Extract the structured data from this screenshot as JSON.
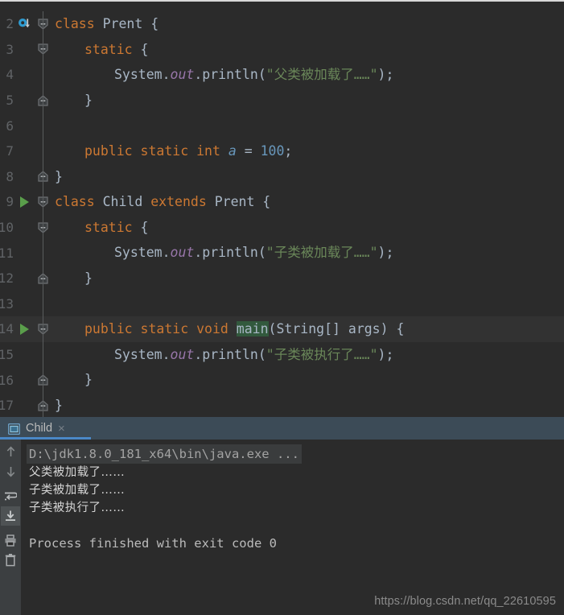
{
  "editor": {
    "lines": [
      {
        "num": "2",
        "marker": "subclass-icon",
        "fold": "open",
        "indent": 0,
        "tokens": [
          {
            "t": "class",
            "c": "kw"
          },
          {
            "t": " ",
            "c": "pun"
          },
          {
            "t": "Prent",
            "c": "cls"
          },
          {
            "t": " {",
            "c": "pun"
          }
        ]
      },
      {
        "num": "3",
        "marker": "none",
        "fold": "open",
        "indent": 1,
        "tokens": [
          {
            "t": "static",
            "c": "kw"
          },
          {
            "t": " {",
            "c": "pun"
          }
        ]
      },
      {
        "num": "4",
        "marker": "none",
        "fold": "line",
        "indent": 2,
        "tokens": [
          {
            "t": "System",
            "c": "cls"
          },
          {
            "t": ".",
            "c": "pun"
          },
          {
            "t": "out",
            "c": "fld"
          },
          {
            "t": ".",
            "c": "pun"
          },
          {
            "t": "println",
            "c": "mth"
          },
          {
            "t": "(",
            "c": "pun"
          },
          {
            "t": "\"父类被加载了……\"",
            "c": "str"
          },
          {
            "t": ");",
            "c": "pun"
          }
        ]
      },
      {
        "num": "5",
        "marker": "none",
        "fold": "close",
        "indent": 1,
        "tokens": [
          {
            "t": "}",
            "c": "pun"
          }
        ]
      },
      {
        "num": "6",
        "marker": "none",
        "fold": "line",
        "indent": 0,
        "tokens": []
      },
      {
        "num": "7",
        "marker": "none",
        "fold": "line",
        "indent": 1,
        "tokens": [
          {
            "t": "public",
            "c": "kw"
          },
          {
            "t": " ",
            "c": "pun"
          },
          {
            "t": "static",
            "c": "kw"
          },
          {
            "t": " ",
            "c": "pun"
          },
          {
            "t": "int",
            "c": "kw"
          },
          {
            "t": " ",
            "c": "pun"
          },
          {
            "t": "a",
            "c": "fldb"
          },
          {
            "t": " = ",
            "c": "pun"
          },
          {
            "t": "100",
            "c": "num"
          },
          {
            "t": ";",
            "c": "pun"
          }
        ]
      },
      {
        "num": "8",
        "marker": "none",
        "fold": "close",
        "indent": 0,
        "tokens": [
          {
            "t": "}",
            "c": "pun"
          }
        ]
      },
      {
        "num": "9",
        "marker": "run-icon",
        "fold": "open",
        "indent": 0,
        "tokens": [
          {
            "t": "class",
            "c": "kw"
          },
          {
            "t": " ",
            "c": "pun"
          },
          {
            "t": "Child",
            "c": "cls"
          },
          {
            "t": " ",
            "c": "pun"
          },
          {
            "t": "extends",
            "c": "kw"
          },
          {
            "t": " ",
            "c": "pun"
          },
          {
            "t": "Prent",
            "c": "cls"
          },
          {
            "t": " {",
            "c": "pun"
          }
        ]
      },
      {
        "num": "10",
        "marker": "none",
        "fold": "open",
        "indent": 1,
        "tokens": [
          {
            "t": "static",
            "c": "kw"
          },
          {
            "t": " {",
            "c": "pun"
          }
        ]
      },
      {
        "num": "11",
        "marker": "none",
        "fold": "line",
        "indent": 2,
        "tokens": [
          {
            "t": "System",
            "c": "cls"
          },
          {
            "t": ".",
            "c": "pun"
          },
          {
            "t": "out",
            "c": "fld"
          },
          {
            "t": ".",
            "c": "pun"
          },
          {
            "t": "println",
            "c": "mth"
          },
          {
            "t": "(",
            "c": "pun"
          },
          {
            "t": "\"子类被加载了……\"",
            "c": "str"
          },
          {
            "t": ");",
            "c": "pun"
          }
        ]
      },
      {
        "num": "12",
        "marker": "none",
        "fold": "close",
        "indent": 1,
        "tokens": [
          {
            "t": "}",
            "c": "pun"
          }
        ]
      },
      {
        "num": "13",
        "marker": "none",
        "fold": "line",
        "indent": 0,
        "tokens": []
      },
      {
        "num": "14",
        "marker": "run-icon",
        "fold": "open",
        "indent": 1,
        "current": true,
        "tokens": [
          {
            "t": "public",
            "c": "kw"
          },
          {
            "t": " ",
            "c": "pun"
          },
          {
            "t": "static",
            "c": "kw"
          },
          {
            "t": " ",
            "c": "pun"
          },
          {
            "t": "void",
            "c": "kw"
          },
          {
            "t": " ",
            "c": "pun"
          },
          {
            "t": "main",
            "c": "mth hl"
          },
          {
            "t": "(",
            "c": "pun"
          },
          {
            "t": "String",
            "c": "cls"
          },
          {
            "t": "[] args) {",
            "c": "pun"
          }
        ]
      },
      {
        "num": "15",
        "marker": "none",
        "fold": "line",
        "indent": 2,
        "tokens": [
          {
            "t": "System",
            "c": "cls"
          },
          {
            "t": ".",
            "c": "pun"
          },
          {
            "t": "out",
            "c": "fld"
          },
          {
            "t": ".",
            "c": "pun"
          },
          {
            "t": "println",
            "c": "mth"
          },
          {
            "t": "(",
            "c": "pun"
          },
          {
            "t": "\"子类被执行了……\"",
            "c": "str"
          },
          {
            "t": ");",
            "c": "pun"
          }
        ]
      },
      {
        "num": "16",
        "marker": "none",
        "fold": "close",
        "indent": 1,
        "tokens": [
          {
            "t": "}",
            "c": "pun"
          }
        ]
      },
      {
        "num": "17",
        "marker": "none",
        "fold": "close",
        "indent": 0,
        "tokens": [
          {
            "t": "}",
            "c": "pun"
          }
        ]
      }
    ],
    "colors": {
      "background": "#2b2b2b",
      "current_line": "#323232",
      "keyword": "#cc7832",
      "string": "#6a8759",
      "number": "#6897bb",
      "field": "#9876aa",
      "default_text": "#a9b7c6",
      "line_number": "#606366",
      "search_highlight": "#32593d"
    }
  },
  "console": {
    "tab": {
      "label": "Child",
      "icon": "console-window-icon",
      "close_label": "×",
      "active": true,
      "underline_color": "#4a88c7",
      "bar_background": "#3c4b57"
    },
    "toolbar": [
      {
        "name": "rerun-failed-tests-up-icon",
        "glyph": "arrow-up"
      },
      {
        "name": "scroll-down-icon",
        "glyph": "arrow-down"
      },
      {
        "name": "soft-wrap-icon",
        "glyph": "wrap"
      },
      {
        "name": "scroll-to-end-icon",
        "glyph": "scroll-end",
        "active": true
      },
      {
        "name": "print-icon",
        "glyph": "print"
      },
      {
        "name": "clear-all-icon",
        "glyph": "trash"
      }
    ],
    "output": [
      {
        "text": "D:\\jdk1.8.0_181_x64\\bin\\java.exe ...",
        "style": "cmd"
      },
      {
        "text": "父类被加载了……",
        "style": "cn"
      },
      {
        "text": "子类被加载了……",
        "style": "cn"
      },
      {
        "text": "子类被执行了……",
        "style": "cn"
      },
      {
        "text": "",
        "style": "blank"
      },
      {
        "text": "Process finished with exit code 0",
        "style": "plain"
      }
    ]
  },
  "watermark": {
    "text": "https://blog.csdn.net/qq_22610595"
  }
}
